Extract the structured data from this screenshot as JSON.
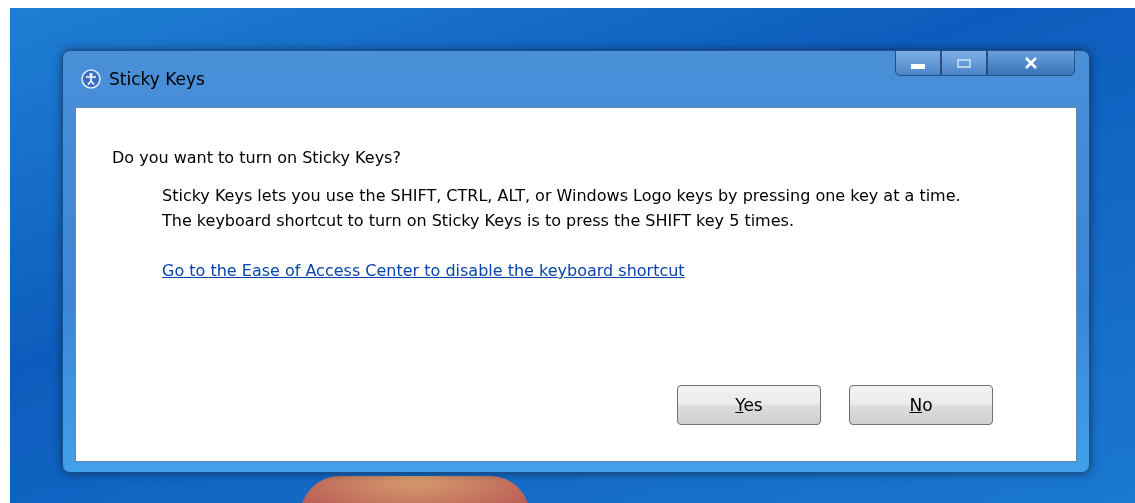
{
  "window": {
    "title": "Sticky Keys"
  },
  "question": "Do you want to turn on Sticky Keys?",
  "description": "Sticky Keys lets you use the SHIFT, CTRL, ALT, or Windows Logo keys by pressing one key at a time. The keyboard shortcut to turn on Sticky Keys is to press the SHIFT key 5 times.",
  "link": "Go to the Ease of Access Center to disable the keyboard shortcut",
  "buttons": [
    {
      "mnemonic": "Y",
      "rest": "es"
    },
    {
      "mnemonic": "N",
      "rest": "o"
    }
  ]
}
